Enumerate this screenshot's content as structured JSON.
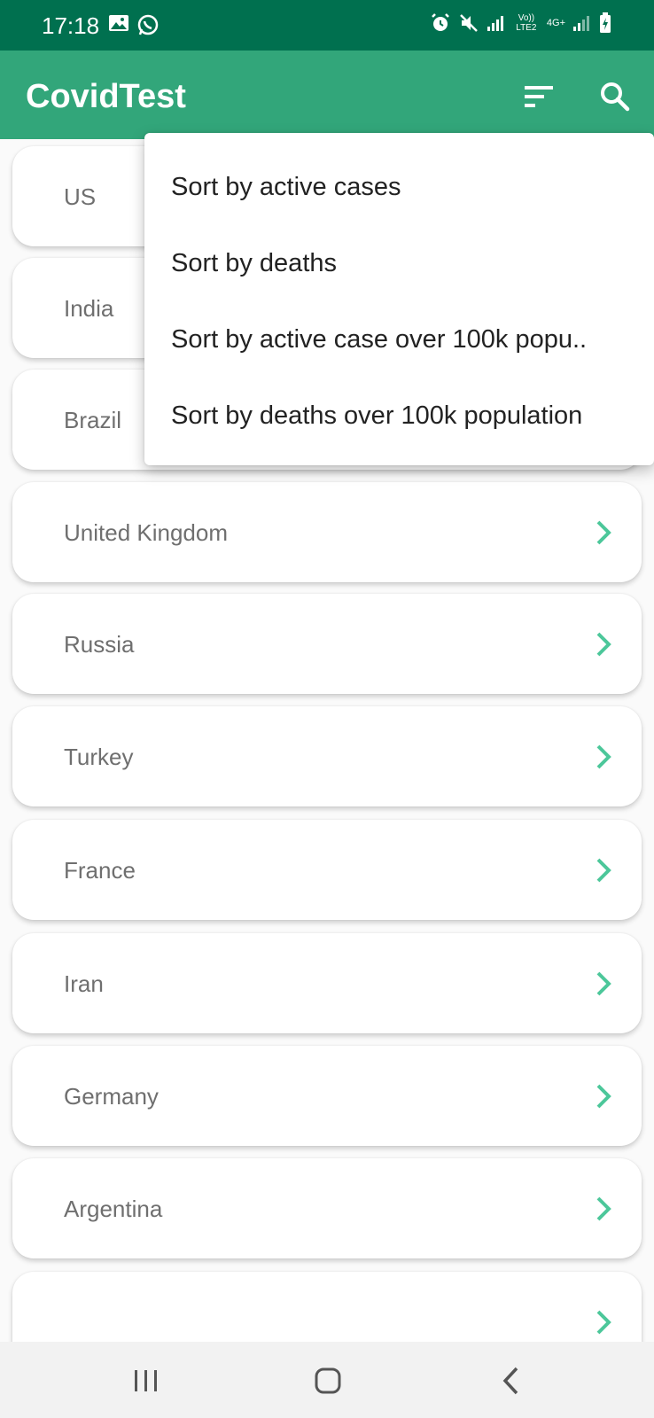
{
  "status_bar": {
    "time": "17:18",
    "left_icons": [
      "gallery-icon",
      "whatsapp-icon"
    ],
    "right_icons": [
      "alarm-icon",
      "mute-icon",
      "signal-icon",
      "volte-icon",
      "4g-icon",
      "signal-icon",
      "battery-charging-icon"
    ],
    "volte_label": "Vo)) LTE2",
    "network_label": "4G+"
  },
  "app_bar": {
    "title": "CovidTest",
    "actions": [
      "sort-icon",
      "search-icon"
    ]
  },
  "countries": [
    {
      "name": "US"
    },
    {
      "name": "India"
    },
    {
      "name": "Brazil"
    },
    {
      "name": "United Kingdom"
    },
    {
      "name": "Russia"
    },
    {
      "name": "Turkey"
    },
    {
      "name": "France"
    },
    {
      "name": "Iran"
    },
    {
      "name": "Germany"
    },
    {
      "name": "Argentina"
    },
    {
      "name": ""
    }
  ],
  "sort_menu": {
    "items": [
      {
        "label": "Sort by active cases"
      },
      {
        "label": "Sort by deaths"
      },
      {
        "label": "Sort by active case over 100k popu.."
      },
      {
        "label": "Sort by deaths over 100k population"
      }
    ]
  },
  "nav_bar": {
    "buttons": [
      "recent-apps-icon",
      "home-icon",
      "back-icon"
    ]
  },
  "colors": {
    "status_bar": "#00704f",
    "app_bar": "#32a67a",
    "chevron": "#4cc79a"
  }
}
